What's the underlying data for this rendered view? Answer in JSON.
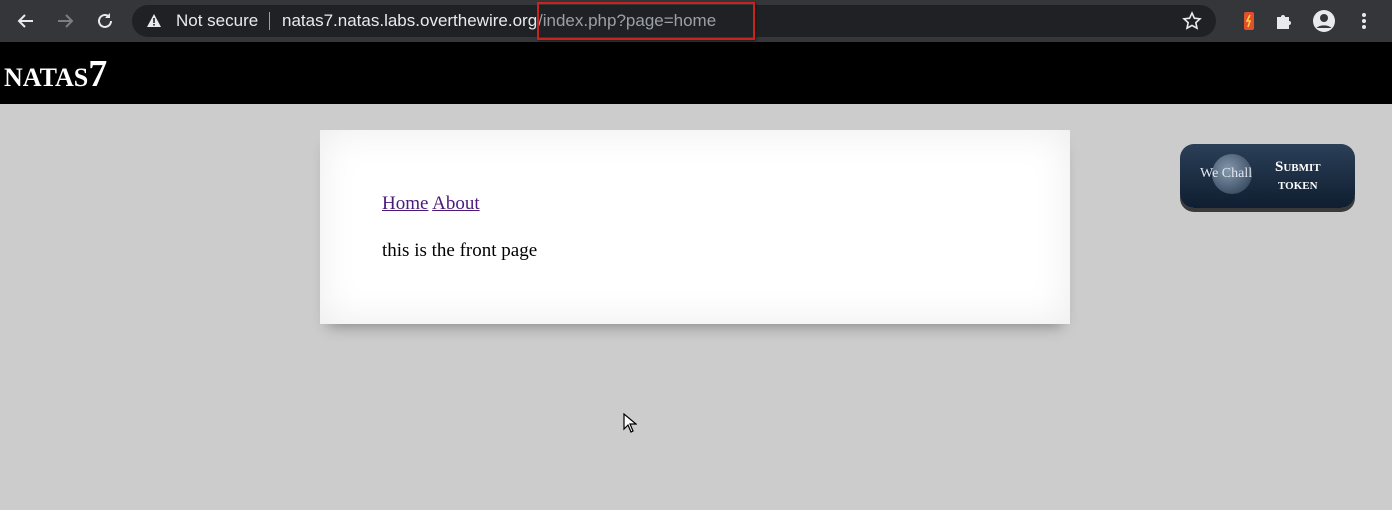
{
  "browser": {
    "security_label": "Not secure",
    "url_host": "natas7.natas.labs.overthewire.org",
    "url_path": "/index.php?page=home",
    "icons": [
      "back-arrow-icon",
      "forward-arrow-icon",
      "reload-icon",
      "warning-icon",
      "star-icon",
      "extension-icon",
      "puzzle-icon",
      "profile-icon",
      "more-icon"
    ]
  },
  "header": {
    "title_name": "NATAS",
    "title_number": "7"
  },
  "content": {
    "nav": {
      "home_label": "Home",
      "about_label": "About"
    },
    "body_text": "this is the front page"
  },
  "token_button": {
    "badge_text": "We Chall",
    "label_line1": "Submit",
    "label_line2": "token"
  },
  "colors": {
    "page_bg": "#cccccc",
    "header_bg": "#000000",
    "highlight": "#c8241d",
    "link": "#4b1a7a"
  }
}
